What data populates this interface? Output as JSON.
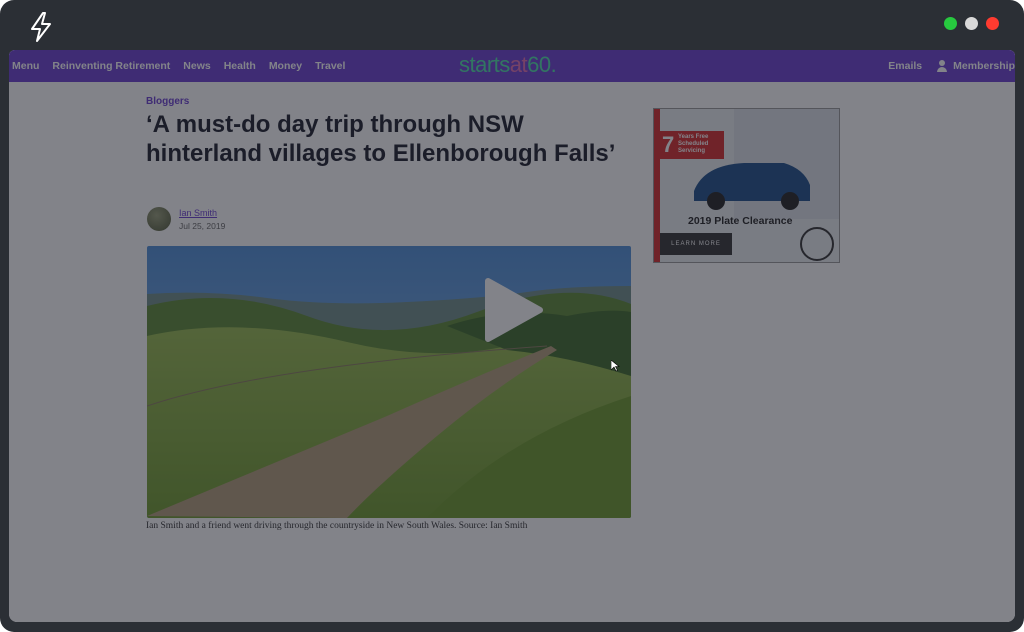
{
  "nav": {
    "items": [
      "Menu",
      "Reinventing Retirement",
      "News",
      "Health",
      "Money",
      "Travel"
    ],
    "brand_starts": "starts",
    "brand_at": "at",
    "brand_60": "60.",
    "emails": "Emails",
    "membership": "Membership"
  },
  "article": {
    "category": "Bloggers",
    "title": "‘A must-do day trip through NSW hinterland villages to Ellenborough Falls’",
    "author": "Ian Smith",
    "date": "Jul 25, 2019",
    "caption": "Ian Smith and a friend went driving through the countryside in New South Wales. Source: Ian Smith"
  },
  "ad": {
    "badge_number": "7",
    "badge_text": "Years Free Scheduled Servicing",
    "title": "2019 Plate Clearance",
    "button": "LEARN MORE"
  },
  "colors": {
    "brand_purple": "#6b3fd1",
    "window_dot_green": "#27c93f",
    "window_dot_grey": "#d9d9d9",
    "window_dot_red": "#ff3b30"
  }
}
